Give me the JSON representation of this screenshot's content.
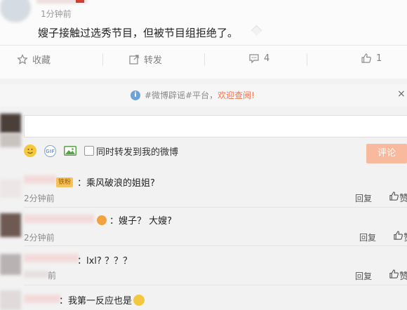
{
  "post": {
    "time": "1分钟前",
    "text": "嫂子接触过选秀节目，但被节目组拒绝了。"
  },
  "actions": {
    "favorite": "收藏",
    "forward": "转发",
    "comment_count": "4",
    "like_count": "1"
  },
  "notice": {
    "icon": "i",
    "text": "#微博辟谣#平台，",
    "link": "欢迎查阅!",
    "close": "×"
  },
  "composer": {
    "gif_label": "GIF",
    "forward_label": "同时转发到我的微博",
    "submit": "评论"
  },
  "comments": [
    {
      "badge": "铁粉",
      "text": "：乘风破浪的姐姐?",
      "time": "2分钟前",
      "reply": "回复",
      "like": "赞"
    },
    {
      "text": "：嫂子？ 大嫂?",
      "time": "2分钟前",
      "reply": "回复",
      "like": "赞"
    },
    {
      "text": "：lxl? ？？？",
      "time": "前",
      "reply": "回复",
      "like": "赞"
    },
    {
      "text": "：我第一反应也是",
      "reply": "回复",
      "like": "赞"
    }
  ],
  "colors": {
    "accent": "#eb7350",
    "button_disabled": "#f8b99c",
    "notice_icon": "#6fa3d8"
  },
  "icons": [
    "star-icon",
    "forward-icon",
    "comment-icon",
    "thumb-up-icon",
    "info-icon",
    "close-icon",
    "emoji-icon",
    "gif-icon",
    "image-icon",
    "laugh-emoji-icon"
  ]
}
